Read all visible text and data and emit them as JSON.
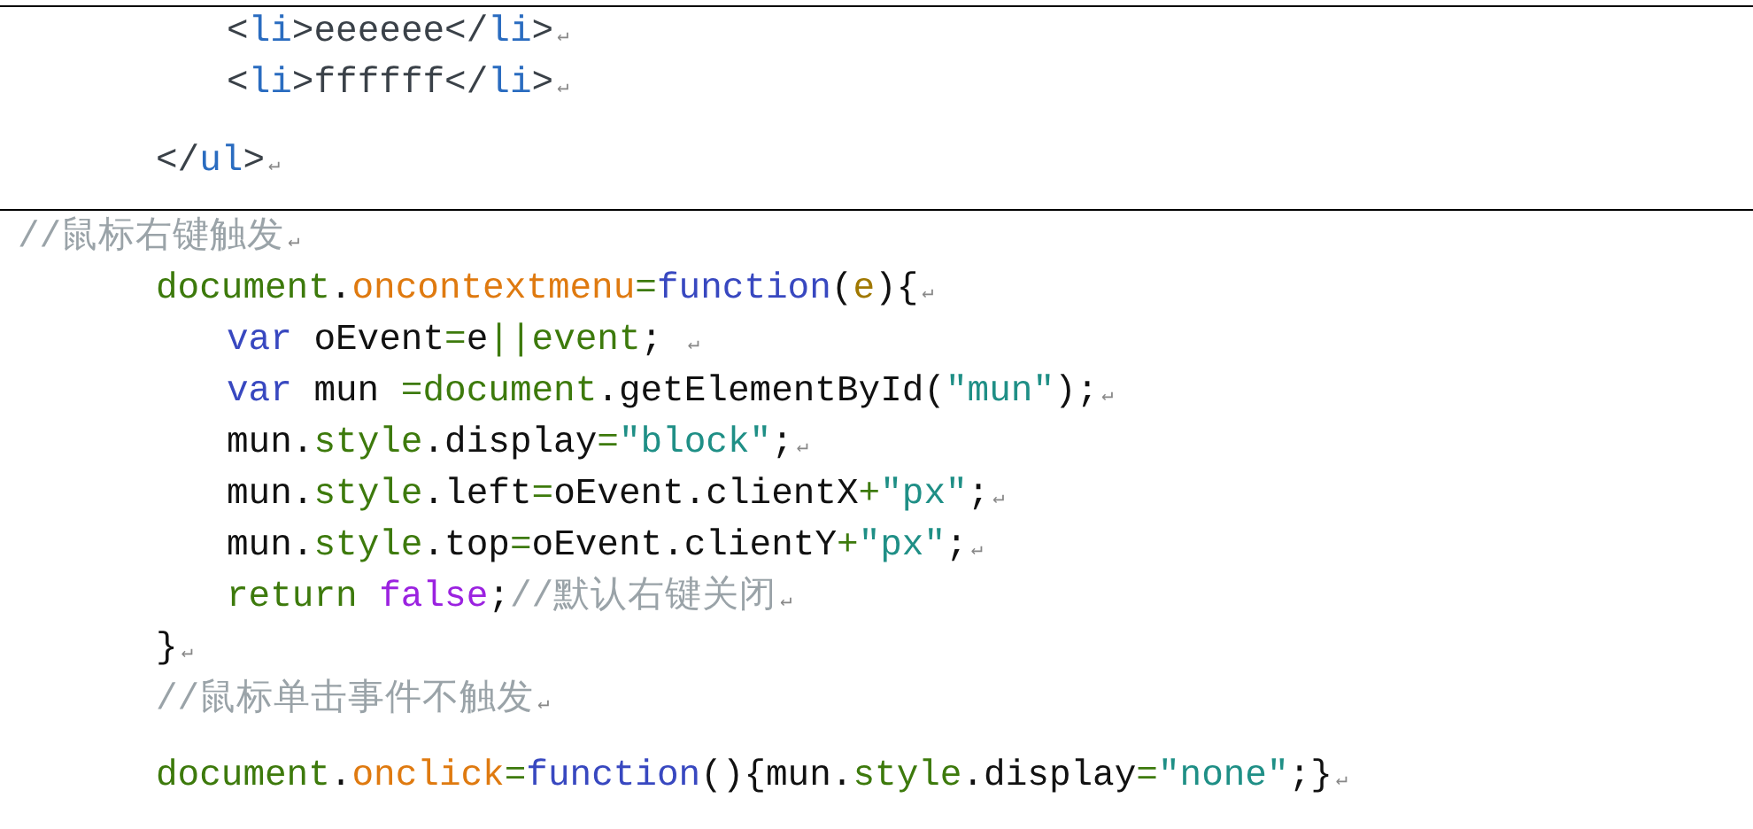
{
  "blocks": [
    {
      "paragraphs": [
        {
          "lines": [
            {
              "kind": "inner",
              "end_mark": "↵",
              "tokens": [
                {
                  "kind": "punct",
                  "text": "<"
                },
                {
                  "kind": "tag",
                  "text": "li"
                },
                {
                  "kind": "punct",
                  "text": ">"
                },
                {
                  "kind": "text",
                  "text": "eeeeee"
                },
                {
                  "kind": "punct",
                  "text": "</"
                },
                {
                  "kind": "tag",
                  "text": "li"
                },
                {
                  "kind": "punct",
                  "text": ">"
                }
              ]
            },
            {
              "kind": "inner",
              "end_mark": "↵",
              "tokens": [
                {
                  "kind": "punct",
                  "text": "<"
                },
                {
                  "kind": "tag",
                  "text": "li"
                },
                {
                  "kind": "punct",
                  "text": ">"
                },
                {
                  "kind": "text",
                  "text": "ffffff"
                },
                {
                  "kind": "punct",
                  "text": "</"
                },
                {
                  "kind": "tag",
                  "text": "li"
                },
                {
                  "kind": "punct",
                  "text": ">"
                }
              ]
            }
          ]
        },
        {
          "lines": [
            {
              "kind": "outer",
              "end_mark": "↵",
              "tokens": [
                {
                  "kind": "punct",
                  "text": "</"
                },
                {
                  "kind": "tag",
                  "text": "ul"
                },
                {
                  "kind": "punct",
                  "text": ">"
                }
              ]
            }
          ]
        }
      ]
    },
    {
      "paragraphs": [
        {
          "lines": [
            {
              "kind": "flush",
              "end_mark": "↵",
              "tokens": [
                {
                  "kind": "comment",
                  "text": "//鼠标右键触发"
                }
              ]
            },
            {
              "kind": "outer",
              "end_mark": "↵",
              "tokens": [
                {
                  "kind": "obj",
                  "text": "document"
                },
                {
                  "kind": "plain",
                  "text": "."
                },
                {
                  "kind": "prop",
                  "text": "oncontextmenu"
                },
                {
                  "kind": "op",
                  "text": "="
                },
                {
                  "kind": "kw",
                  "text": "function"
                },
                {
                  "kind": "plain",
                  "text": "("
                },
                {
                  "kind": "param",
                  "text": "e"
                },
                {
                  "kind": "plain",
                  "text": "){"
                }
              ]
            },
            {
              "kind": "inner",
              "end_mark": "↵",
              "tokens": [
                {
                  "kind": "kw",
                  "text": "var"
                },
                {
                  "kind": "plain",
                  "text": " oEvent"
                },
                {
                  "kind": "op",
                  "text": "="
                },
                {
                  "kind": "plain",
                  "text": "e"
                },
                {
                  "kind": "op",
                  "text": "||"
                },
                {
                  "kind": "obj",
                  "text": "event"
                },
                {
                  "kind": "plain",
                  "text": "; "
                }
              ]
            },
            {
              "kind": "inner",
              "end_mark": "↵",
              "tokens": [
                {
                  "kind": "kw",
                  "text": "var"
                },
                {
                  "kind": "plain",
                  "text": " mun "
                },
                {
                  "kind": "op",
                  "text": "="
                },
                {
                  "kind": "obj",
                  "text": "document"
                },
                {
                  "kind": "plain",
                  "text": ".getElementById("
                },
                {
                  "kind": "str",
                  "text": "\"mun\""
                },
                {
                  "kind": "plain",
                  "text": ");"
                }
              ]
            },
            {
              "kind": "inner",
              "end_mark": "↵",
              "tokens": [
                {
                  "kind": "plain",
                  "text": "mun."
                },
                {
                  "kind": "obj",
                  "text": "style"
                },
                {
                  "kind": "plain",
                  "text": ".display"
                },
                {
                  "kind": "op",
                  "text": "="
                },
                {
                  "kind": "str",
                  "text": "\"block\""
                },
                {
                  "kind": "plain",
                  "text": ";"
                }
              ]
            },
            {
              "kind": "inner",
              "end_mark": "↵",
              "tokens": [
                {
                  "kind": "plain",
                  "text": "mun."
                },
                {
                  "kind": "obj",
                  "text": "style"
                },
                {
                  "kind": "plain",
                  "text": ".left"
                },
                {
                  "kind": "op",
                  "text": "="
                },
                {
                  "kind": "plain",
                  "text": "oEvent.clientX"
                },
                {
                  "kind": "op",
                  "text": "+"
                },
                {
                  "kind": "str",
                  "text": "\"px\""
                },
                {
                  "kind": "plain",
                  "text": ";"
                }
              ]
            },
            {
              "kind": "inner",
              "end_mark": "↵",
              "tokens": [
                {
                  "kind": "plain",
                  "text": "mun."
                },
                {
                  "kind": "obj",
                  "text": "style"
                },
                {
                  "kind": "plain",
                  "text": ".top"
                },
                {
                  "kind": "op",
                  "text": "="
                },
                {
                  "kind": "plain",
                  "text": "oEvent.clientY"
                },
                {
                  "kind": "op",
                  "text": "+"
                },
                {
                  "kind": "str",
                  "text": "\"px\""
                },
                {
                  "kind": "plain",
                  "text": ";"
                }
              ]
            },
            {
              "kind": "inner",
              "end_mark": "↵",
              "tokens": [
                {
                  "kind": "obj",
                  "text": "return "
                },
                {
                  "kind": "bool",
                  "text": "false"
                },
                {
                  "kind": "plain",
                  "text": ";"
                },
                {
                  "kind": "comment",
                  "text": "//默认右键关闭"
                }
              ]
            },
            {
              "kind": "outer",
              "end_mark": "↵",
              "tokens": [
                {
                  "kind": "plain",
                  "text": "}"
                }
              ]
            },
            {
              "kind": "outer",
              "end_mark": "↵",
              "tokens": [
                {
                  "kind": "comment",
                  "text": "//鼠标单击事件不触发"
                }
              ]
            }
          ]
        },
        {
          "lines": [
            {
              "kind": "outer",
              "end_mark": "↵",
              "tokens": [
                {
                  "kind": "obj",
                  "text": "document"
                },
                {
                  "kind": "plain",
                  "text": "."
                },
                {
                  "kind": "prop",
                  "text": "onclick"
                },
                {
                  "kind": "op",
                  "text": "="
                },
                {
                  "kind": "kw",
                  "text": "function"
                },
                {
                  "kind": "plain",
                  "text": "(){mun."
                },
                {
                  "kind": "obj",
                  "text": "style"
                },
                {
                  "kind": "plain",
                  "text": ".display"
                },
                {
                  "kind": "op",
                  "text": "="
                },
                {
                  "kind": "str",
                  "text": "\"none\""
                },
                {
                  "kind": "plain",
                  "text": ";}"
                }
              ]
            }
          ]
        }
      ]
    }
  ]
}
